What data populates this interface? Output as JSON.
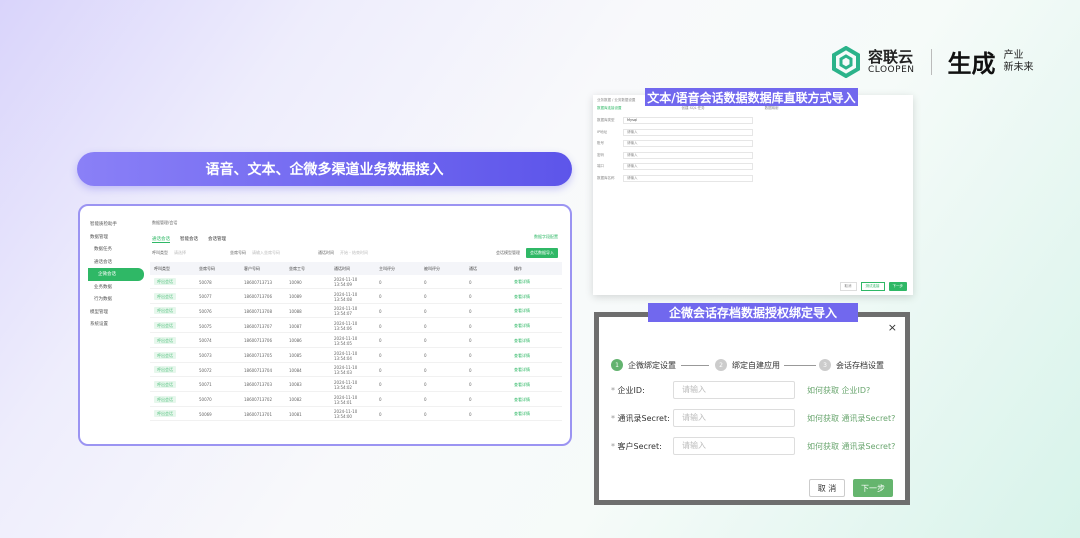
{
  "brand": {
    "name_cn": "容联云",
    "name_en": "CLOOPEN",
    "slogan_big": "生成",
    "slogan_1": "产业",
    "slogan_2": "新未来",
    "accent": "#2bb38a"
  },
  "banner": "语音、文本、企微多渠道业务数据接入",
  "left_app": {
    "sidebar": [
      {
        "label": "智能质检助手"
      },
      {
        "label": "数据管理"
      },
      {
        "label": "数据任务"
      },
      {
        "label": "通话会话"
      },
      {
        "label": "企微会话"
      },
      {
        "label": "业务数据"
      },
      {
        "label": "行为数据"
      },
      {
        "label": "模型管理"
      },
      {
        "label": "系统设置"
      }
    ],
    "breadcrumb": "数据管理/会话",
    "tabs": [
      "通话会话",
      "智能会话",
      "会话管理"
    ],
    "filters": {
      "type": "呼叫类型",
      "type_ph": "请选择",
      "agent": "坐席号码",
      "agent_ph": "请输入坐席号码",
      "time": "通话时间",
      "time_ph": "开始 - 结束时间"
    },
    "top_link": "数据字段配置",
    "buttons": {
      "manage": "会话模型管理",
      "import": "会话数据导入"
    },
    "columns": [
      "呼叫类型",
      "坐席号码",
      "客户号码",
      "坐席工号",
      "通话时间",
      "主叫评分",
      "被叫评分",
      "通话",
      "操作"
    ],
    "rows": [
      [
        "呼出会话",
        "50078",
        "18600713713",
        "10090",
        "2024-11-10 13:54:09",
        "0",
        "0",
        "0",
        "查看详情"
      ],
      [
        "呼出会话",
        "50077",
        "18600713706",
        "10089",
        "2024-11-10 13:54:08",
        "0",
        "0",
        "0",
        "查看详情"
      ],
      [
        "呼出会话",
        "50076",
        "18600713708",
        "10088",
        "2024-11-10 13:54:07",
        "0",
        "0",
        "0",
        "查看详情"
      ],
      [
        "呼出会话",
        "50075",
        "18600713707",
        "10087",
        "2024-11-10 13:54:06",
        "0",
        "0",
        "0",
        "查看详情"
      ],
      [
        "呼出会话",
        "50074",
        "18600713706",
        "10086",
        "2024-11-10 13:54:05",
        "0",
        "0",
        "0",
        "查看详情"
      ],
      [
        "呼出会话",
        "50073",
        "18600713705",
        "10085",
        "2024-11-10 13:54:04",
        "0",
        "0",
        "0",
        "查看详情"
      ],
      [
        "呼出会话",
        "50072",
        "18600713704",
        "10084",
        "2024-11-10 13:54:03",
        "0",
        "0",
        "0",
        "查看详情"
      ],
      [
        "呼出会话",
        "50071",
        "18600713703",
        "10083",
        "2024-11-10 13:54:02",
        "0",
        "0",
        "0",
        "查看详情"
      ],
      [
        "呼出会话",
        "50070",
        "18600713702",
        "10082",
        "2024-11-10 13:54:01",
        "0",
        "0",
        "0",
        "查看详情"
      ],
      [
        "呼出会话",
        "50069",
        "18600713701",
        "10081",
        "2024-11-10 13:54:00",
        "0",
        "0",
        "0",
        "查看详情"
      ]
    ]
  },
  "db_label": "文本/语音会话数据数据库直联方式导入",
  "db_app": {
    "breadcrumb": "业务数据 / 业务数据设置",
    "steps": [
      "数据库连接设置",
      "创建 SQL 任务",
      "数据映射"
    ],
    "fields": [
      {
        "k": "数据库类型",
        "v": "Mysql"
      },
      {
        "k": "IP地址",
        "v": "请输入"
      },
      {
        "k": "账号",
        "v": "请输入"
      },
      {
        "k": "密码",
        "v": "请输入"
      },
      {
        "k": "端口",
        "v": "请输入"
      },
      {
        "k": "数据库名称",
        "v": "请输入"
      }
    ],
    "buttons": {
      "cancel": "取消",
      "test": "测试连接",
      "next": "下一步"
    }
  },
  "wx_label": "企微会话存档数据授权绑定导入",
  "wx_dialog": {
    "steps": [
      "企微绑定设置",
      "绑定自建应用",
      "会话存档设置"
    ],
    "fields": [
      {
        "label": "企业ID:",
        "placeholder": "请输入",
        "help": "如何获取 企业ID?"
      },
      {
        "label": "通讯录Secret:",
        "placeholder": "请输入",
        "help": "如何获取 通讯录Secret?"
      },
      {
        "label": "客户Secret:",
        "placeholder": "请输入",
        "help": "如何获取 通讯录Secret?"
      }
    ],
    "cancel": "取 消",
    "next": "下一步"
  }
}
